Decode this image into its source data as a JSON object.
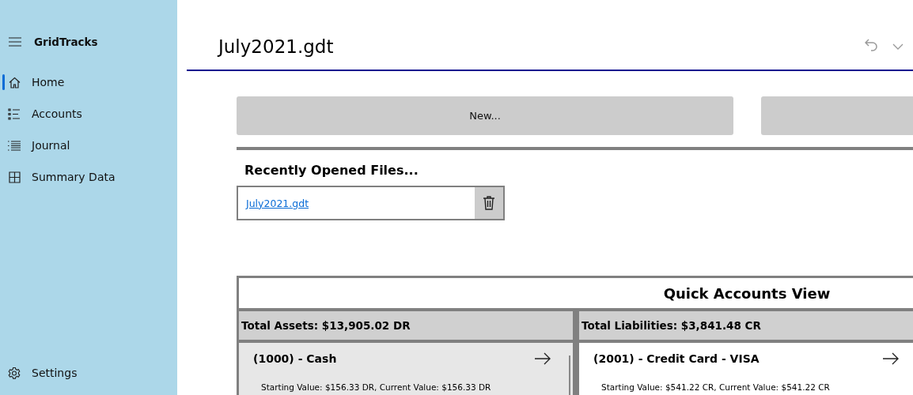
{
  "app": {
    "title": "GridTracks"
  },
  "nav": [
    {
      "label": "Home",
      "selected": true
    },
    {
      "label": "Accounts",
      "selected": false
    },
    {
      "label": "Journal",
      "selected": false
    },
    {
      "label": "Summary Data",
      "selected": false
    }
  ],
  "settings": {
    "label": "Settings"
  },
  "document": {
    "title": "July2021.gdt"
  },
  "buttons": [
    {
      "label": "New..."
    }
  ],
  "recent_files": {
    "heading": "Recently Opened Files...",
    "files": [
      "July2021.gdt"
    ]
  },
  "quick_accounts": {
    "title": "Quick Accounts View",
    "columns": [
      {
        "header": "Total Assets: $13,905.02 DR",
        "accounts": [
          {
            "name": "(1000) - Cash",
            "detail": "Starting Value: $156.33 DR, Current Value: $156.33 DR",
            "selected": true
          }
        ]
      },
      {
        "header": "Total Liabilities: $3,841.48 CR",
        "accounts": [
          {
            "name": "(2001) - Credit Card - VISA",
            "detail": "Starting Value: $541.22 CR, Current Value: $541.22 CR",
            "selected": false
          }
        ]
      }
    ]
  }
}
